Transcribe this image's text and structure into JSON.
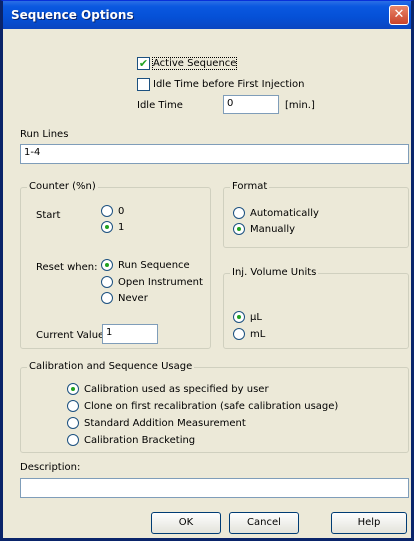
{
  "window": {
    "title": "Sequence Options",
    "close_glyph": "✕"
  },
  "top": {
    "active_sequence": {
      "label": "Active Sequence",
      "checked": true
    },
    "idle_before_first": {
      "label": "Idle Time before First Injection",
      "checked": false
    },
    "idle_time": {
      "label": "Idle Time",
      "value": "0",
      "unit": "[min.]"
    }
  },
  "run_lines": {
    "label": "Run Lines",
    "value": "1-4"
  },
  "counter": {
    "legend": "Counter (%n)",
    "start_label": "Start",
    "start_options": [
      {
        "label": "0",
        "selected": false
      },
      {
        "label": "1",
        "selected": true
      }
    ],
    "reset_label": "Reset when:",
    "reset_options": [
      {
        "label": "Run Sequence",
        "selected": true
      },
      {
        "label": "Open Instrument",
        "selected": false
      },
      {
        "label": "Never",
        "selected": false
      }
    ],
    "current_value_label": "Current Value",
    "current_value": "1"
  },
  "format": {
    "legend": "Format",
    "options": [
      {
        "label": "Automatically",
        "selected": false
      },
      {
        "label": "Manually",
        "selected": true
      }
    ]
  },
  "inj_volume": {
    "legend": "Inj. Volume Units",
    "options": [
      {
        "label": "µL",
        "selected": true
      },
      {
        "label": "mL",
        "selected": false
      }
    ]
  },
  "calibration": {
    "legend": "Calibration and Sequence Usage",
    "options": [
      {
        "label": "Calibration used as specified by user",
        "selected": true
      },
      {
        "label": "Clone on first recalibration (safe calibration usage)",
        "selected": false
      },
      {
        "label": "Standard Addition Measurement",
        "selected": false
      },
      {
        "label": "Calibration Bracketing",
        "selected": false
      }
    ]
  },
  "description": {
    "label": "Description:",
    "value": ""
  },
  "buttons": {
    "ok": "OK",
    "cancel": "Cancel",
    "help": "Help"
  },
  "icons": {
    "check": "✔"
  },
  "colors": {
    "title_bar": "#0550d6",
    "dialog_bg": "#ece9d8",
    "radio_dot": "#21a121",
    "close": "#c9422a"
  }
}
